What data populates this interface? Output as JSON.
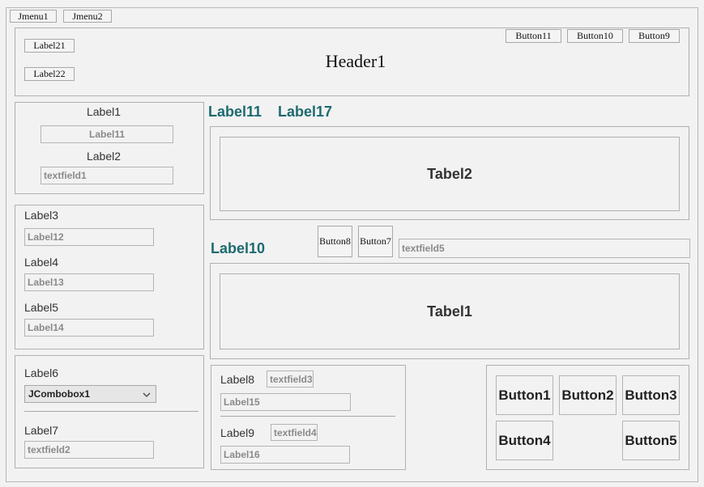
{
  "menu": {
    "items": [
      "Jmenu1",
      "Jmenu2"
    ]
  },
  "header": {
    "title": "Header1",
    "labels": [
      "Label21",
      "Label22"
    ],
    "buttons": [
      "Button11",
      "Button10",
      "Button9"
    ]
  },
  "panel_a": {
    "label1": "Label1",
    "field11": "Label11",
    "label2": "Label2",
    "textfield1": "textfield1"
  },
  "panel_b": {
    "label3": "Label3",
    "field12": "Label12",
    "label4": "Label4",
    "field13": "Label13",
    "label5": "Label5",
    "field14": "Label14"
  },
  "panel_c": {
    "label6": "Label6",
    "combo_value": "JCombobox1",
    "label7": "Label7",
    "textfield2": "textfield2"
  },
  "top_labels": {
    "label11": "Label11",
    "label17": "Label17"
  },
  "tabel2": "Tabel2",
  "middle": {
    "label10": "Label10",
    "button8": "Button8",
    "button7": "Button7",
    "textfield5": "textfield5"
  },
  "tabel1": "Tabel1",
  "panel_d": {
    "label8": "Label8",
    "textfield3": "textfield3",
    "field15": "Label15",
    "label9": "Label9",
    "textfield4": "textfield4",
    "field16": "Label16"
  },
  "buttons_panel": [
    "Button1",
    "Button2",
    "Button3",
    "Button4",
    "Button5"
  ],
  "icons": {
    "combo_arrow": "chevron-down-icon"
  }
}
